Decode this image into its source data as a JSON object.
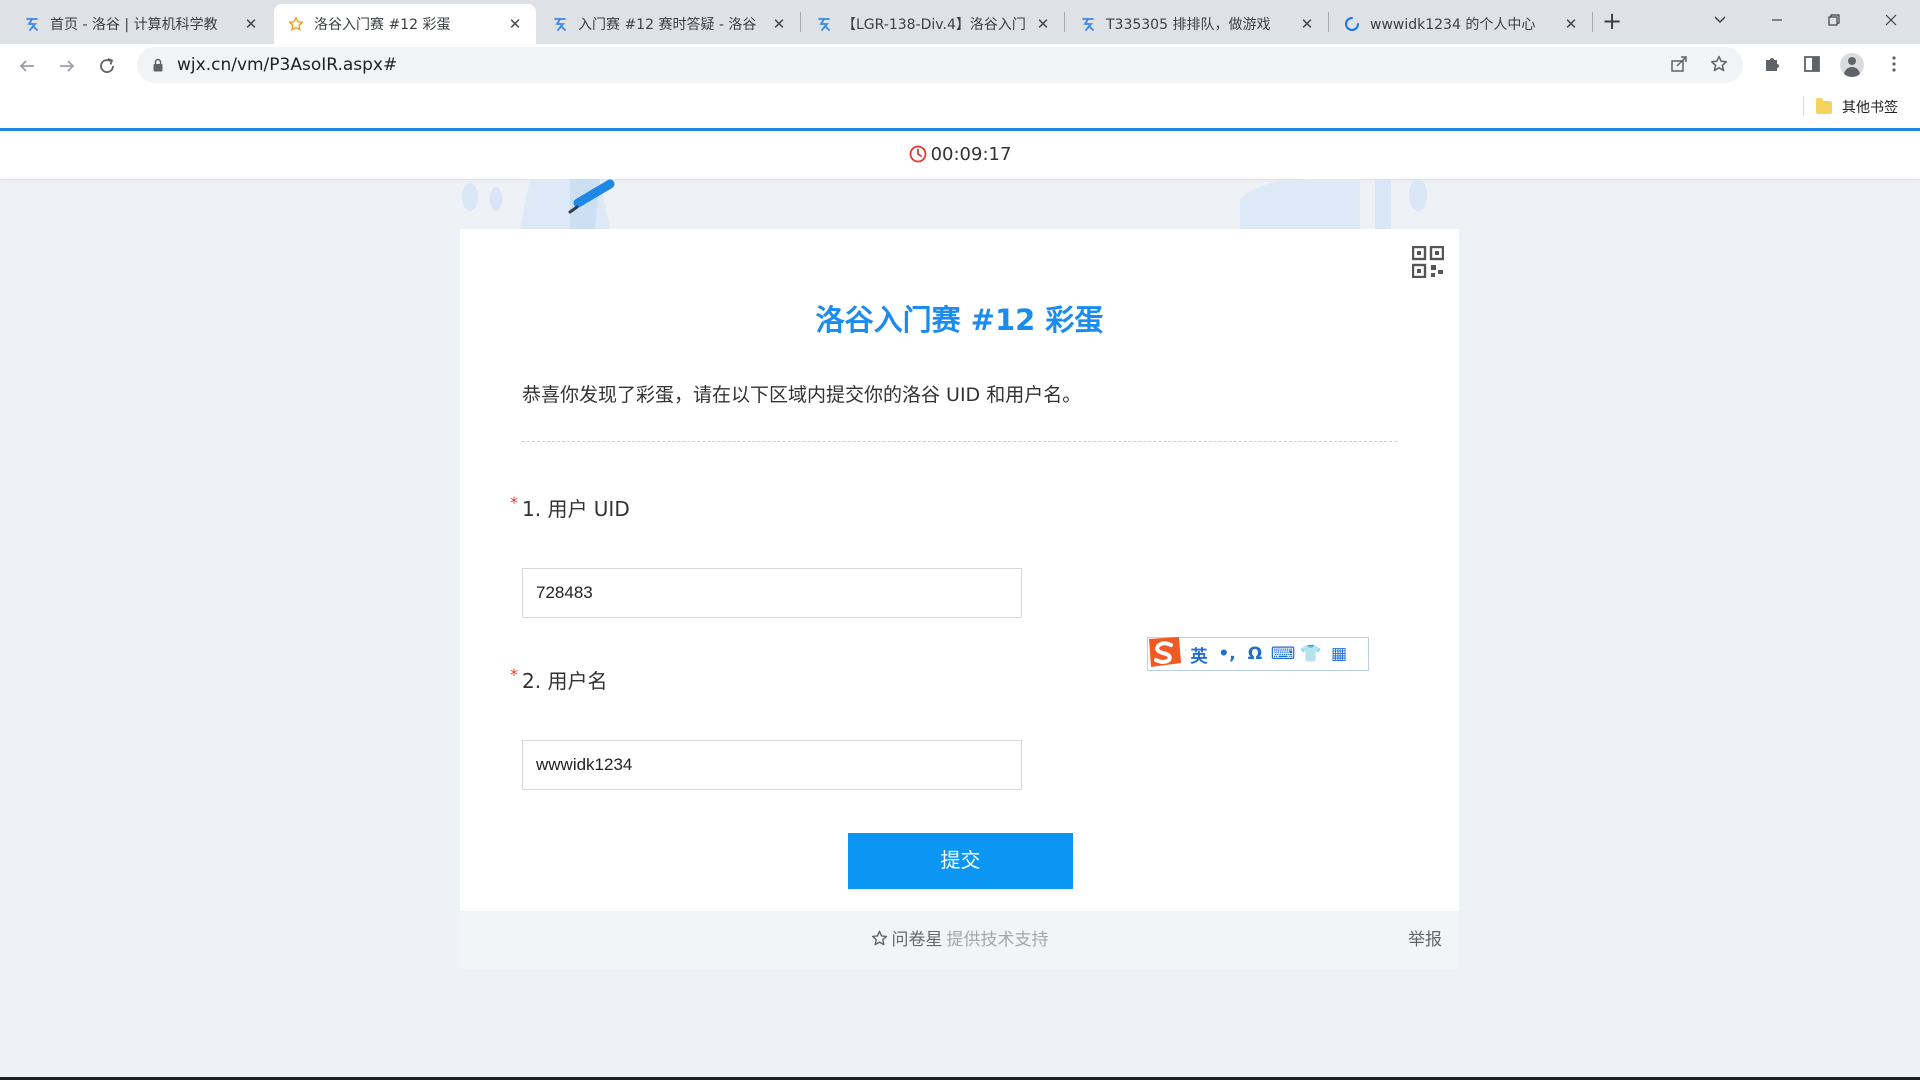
{
  "browser": {
    "tabs": [
      {
        "title": "首页 - 洛谷 | 计算机科学教",
        "favicon": "luogu-icon",
        "active": false
      },
      {
        "title": "洛谷入门赛 #12 彩蛋",
        "favicon": "star-icon",
        "active": true
      },
      {
        "title": "入门赛 #12 赛时答疑 - 洛谷",
        "favicon": "luogu-icon",
        "active": false
      },
      {
        "title": "【LGR-138-Div.4】洛谷入门",
        "favicon": "luogu-icon",
        "active": false
      },
      {
        "title": "T335305 排排队，做游戏",
        "favicon": "luogu-icon",
        "active": false
      },
      {
        "title": "wwwidk1234 的个人中心",
        "favicon": "loading-spinner-icon",
        "active": false
      }
    ],
    "url": "wjx.cn/vm/P3AsoIR.aspx#",
    "bookmarks": {
      "other_folder": "其他书签"
    },
    "accent_color": "#1e88e5"
  },
  "survey": {
    "timer": "00:09:17",
    "title": "洛谷入门赛 #12 彩蛋",
    "description": "恭喜你发现了彩蛋，请在以下区域内提交你的洛谷 UID 和用户名。",
    "questions": [
      {
        "required_mark": "*",
        "label": "1. 用户 UID",
        "value": "728483"
      },
      {
        "required_mark": "*",
        "label": "2. 用户名",
        "value": "wwwidk1234"
      }
    ],
    "submit_label": "提交",
    "footer": {
      "brand": "问卷星",
      "support": "提供技术支持",
      "report": "举报"
    },
    "title_color": "#1a8cf0",
    "button_color": "#0b96f3"
  },
  "ime_toolbar": {
    "items": [
      "英",
      "•,",
      "Ω",
      "⌨",
      "👕",
      "▦"
    ]
  }
}
